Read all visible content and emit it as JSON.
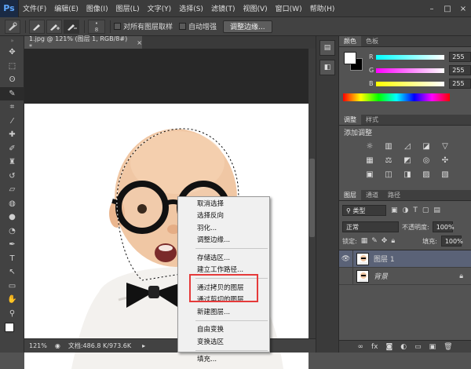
{
  "app": {
    "logo": "Ps"
  },
  "menubar": {
    "items": [
      "文件(F)",
      "编辑(E)",
      "图像(I)",
      "图层(L)",
      "文字(Y)",
      "选择(S)",
      "滤镜(T)",
      "视图(V)",
      "窗口(W)",
      "帮助(H)"
    ],
    "window_controls": [
      "–",
      "□",
      "×"
    ]
  },
  "options_bar": {
    "brush_size": "8",
    "sample_all_label": "对所有图层取样",
    "auto_enhance_label": "自动增强",
    "refine_edge_label": "调整边缘..."
  },
  "document": {
    "tab_title": "1.jpg @ 121% (图层 1, RGB/8#) *",
    "tab_close": "×"
  },
  "status": {
    "zoom": "121%",
    "doc_info": "文档:486.8 K/973.6K"
  },
  "color_panel": {
    "tabs": [
      "颜色",
      "色板"
    ],
    "channels": [
      {
        "label": "R",
        "value": "255",
        "gradient": "#00ffff"
      },
      {
        "label": "G",
        "value": "255",
        "gradient": "#ff00ff"
      },
      {
        "label": "B",
        "value": "255",
        "gradient": "#ffff00"
      }
    ]
  },
  "adjust_panel": {
    "tabs": [
      "调整",
      "样式"
    ],
    "title": "添加调整"
  },
  "layers_panel": {
    "tabs": [
      "图层",
      "通道",
      "路径"
    ],
    "filter_label": "类型",
    "blend_mode": "正常",
    "opacity_label": "不透明度:",
    "opacity_value": "100%",
    "lock_label": "锁定:",
    "fill_label": "填充:",
    "fill_value": "100%",
    "layers": [
      {
        "name": "图层 1",
        "selected": true,
        "visible": true
      },
      {
        "name": "背景",
        "selected": false,
        "visible": false
      }
    ]
  },
  "context_menu": {
    "groups": [
      [
        "取消选择",
        "选择反向",
        "羽化...",
        "调整边缘..."
      ],
      [
        "存储选区...",
        "建立工作路径..."
      ],
      [
        "通过拷贝的图层",
        "通过剪切的图层",
        "新建图层..."
      ],
      [
        "自由变换",
        "变换选区"
      ],
      [
        "填充..."
      ]
    ]
  },
  "colors": {
    "highlight": "#e53a3a",
    "selected_layer": "#5a6277"
  }
}
